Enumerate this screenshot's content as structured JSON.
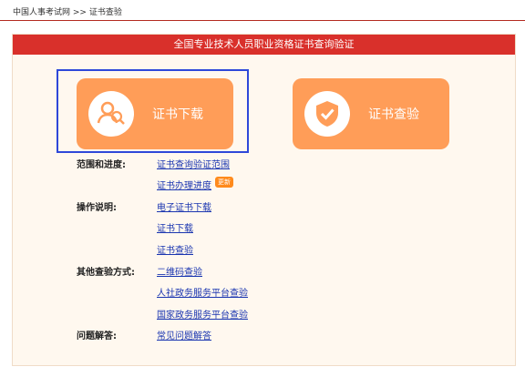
{
  "breadcrumb": {
    "home": "中国人事考试网",
    "separator": ">>",
    "current": "证书查验"
  },
  "panel": {
    "title": "全国专业技术人员职业资格证书查询验证"
  },
  "cards": {
    "download": {
      "label": "证书下载",
      "icon": "user-search-icon"
    },
    "verify": {
      "label": "证书查验",
      "icon": "shield-check-icon"
    }
  },
  "sections": {
    "scope_label": "范围和进度:",
    "scope_link": "证书查询验证范围",
    "progress_link": "证书办理进度",
    "progress_badge": "更新",
    "ops_label": "操作说明:",
    "op1": "电子证书下载",
    "op2": "证书下载",
    "op3": "证书查验",
    "other_label": "其他查验方式:",
    "other1": "二维码查验",
    "other2": "人社政务服务平台查验",
    "other3": "国家政务服务平台查验",
    "faq_label": "问题解答:",
    "faq_link": "常见问题解答"
  },
  "colors": {
    "accent": "#d9302b",
    "card": "#ff9d58",
    "link": "#1a35b0",
    "highlight": "#2e48d9"
  }
}
